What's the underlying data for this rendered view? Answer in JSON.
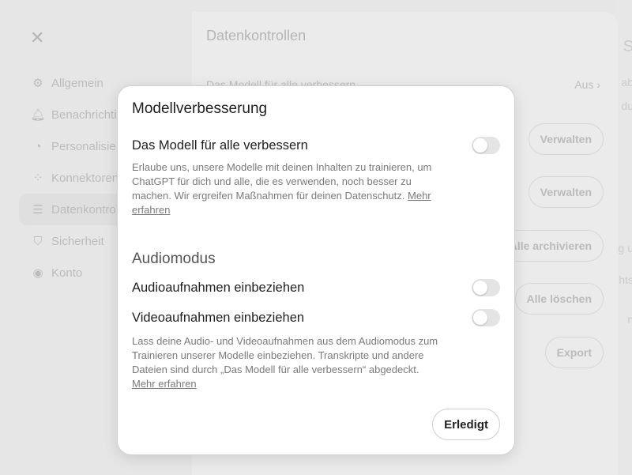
{
  "background": {
    "right_snippets": [
      "S",
      "ab",
      "du",
      "g u",
      "hts",
      "n"
    ],
    "sidebar": {
      "items": [
        {
          "label": "Allgemein",
          "icon": "gear-icon"
        },
        {
          "label": "Benachrichti",
          "icon": "bell-icon"
        },
        {
          "label": "Personalisie",
          "icon": "personalize-icon"
        },
        {
          "label": "Konnektoren",
          "icon": "connectors-icon"
        },
        {
          "label": "Datenkontro",
          "icon": "database-icon"
        },
        {
          "label": "Sicherheit",
          "icon": "shield-icon"
        },
        {
          "label": "Konto",
          "icon": "user-circle-icon"
        }
      ]
    },
    "main": {
      "title": "Datenkontrollen",
      "first_row": "Das Modell für alle verbessern",
      "first_row_value": "Aus",
      "buttons": [
        "Verwalten",
        "Verwalten",
        "Alle archivieren",
        "Alle löschen",
        "Export"
      ]
    }
  },
  "modal": {
    "title": "Modellverbesserung",
    "option_improve": {
      "label": "Das Modell für alle verbessern",
      "enabled": false,
      "description": "Erlaube uns, unsere Modelle mit deinen Inhalten zu trainieren, um ChatGPT für dich und alle, die es verwenden, noch besser zu machen. Wir ergreifen Maßnahmen für deinen Datenschutz.",
      "link": "Mehr erfahren"
    },
    "audio_section": {
      "title": "Audiomodus",
      "audio_label": "Audioaufnahmen einbeziehen",
      "audio_enabled": false,
      "video_label": "Videoaufnahmen einbeziehen",
      "video_enabled": false,
      "description": "Lass deine Audio- und Videoaufnahmen aus dem Audiomodus zum Trainieren unserer Modelle einbeziehen. Transkripte und andere Dateien sind durch „Das Modell für alle verbessern“ abgedeckt.",
      "link": "Mehr erfahren"
    },
    "done_label": "Erledigt"
  }
}
